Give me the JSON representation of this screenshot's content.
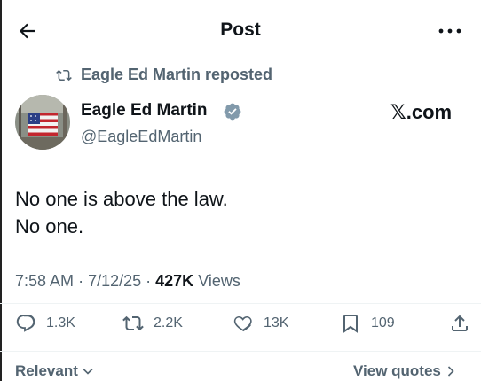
{
  "header": {
    "title": "Post",
    "back_icon": "arrow-left-icon",
    "more_icon": "more-horizontal-icon"
  },
  "repost": {
    "text": "Eagle Ed Martin reposted",
    "icon": "repost-icon"
  },
  "author": {
    "name": "Eagle Ed Martin",
    "handle": "@EagleEdMartin",
    "verified_icon": "verified-badge-icon",
    "source": "𝕏.com"
  },
  "post": {
    "line1": "No one is above the law.",
    "line2": "No one."
  },
  "meta": {
    "time": "7:58 AM",
    "date": "7/12/25",
    "views_count": "427K",
    "views_label": "Views"
  },
  "actions": {
    "replies": "1.3K",
    "reposts": "2.2K",
    "likes": "13K",
    "bookmarks": "109"
  },
  "footer": {
    "sort_label": "Relevant",
    "quotes_label": "View quotes"
  },
  "colors": {
    "text": "#0f1419",
    "muted": "#536471",
    "border": "#eff3f4",
    "verified": "#829aab"
  }
}
